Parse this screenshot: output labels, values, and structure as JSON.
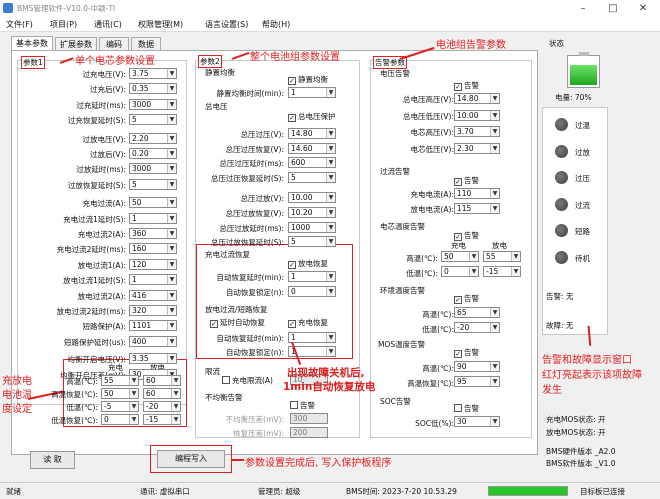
{
  "window": {
    "title": "BMS管理软件-V10.0-中颖-TI",
    "controls": [
      "–",
      "□",
      "✕"
    ]
  },
  "menu": [
    "文件(F)",
    "项目(P)",
    "通讯(C)",
    "权限管理(M)",
    "语言设置(S)",
    "帮助(H)"
  ],
  "tabs": [
    "基本参数",
    "扩展参数",
    "编码",
    "数据"
  ],
  "cell": {
    "title": "参数1",
    "rows": [
      [
        "过充电压(V):",
        "3.75"
      ],
      [
        "过充后(V):",
        "0.35"
      ],
      [
        "过充延时(ms):",
        "3000"
      ],
      [
        "过充恢复延时(S):",
        "5"
      ],
      [
        "过放电压(V):",
        "2.20"
      ],
      [
        "过放后(V):",
        "0.20"
      ],
      [
        "过放延时(ms):",
        "3000"
      ],
      [
        "过放恢复延时(S):",
        "5"
      ],
      [
        "充电过流(A):",
        "50"
      ],
      [
        "充电过流1延时(S):",
        "1"
      ],
      [
        "充电过流2(A):",
        "360"
      ],
      [
        "充电过流2延时(ms):",
        "160"
      ],
      [
        "放电过流1(A):",
        "120"
      ],
      [
        "放电过流1延时(S):",
        "1"
      ],
      [
        "放电过流2(A):",
        "416"
      ],
      [
        "放电过流2延时(ms):",
        "320"
      ],
      [
        "短路保护(A):",
        "1101"
      ],
      [
        "短路保护延时(us):",
        "400"
      ],
      [
        "均衡开启电压(V):",
        "3.35"
      ],
      [
        "均衡开启压差(mV):",
        "30"
      ]
    ],
    "temp": {
      "h1": "充电",
      "h2": "放电",
      "rows": [
        [
          "高温(℃):",
          "55",
          "60"
        ],
        [
          "高温恢复(℃):",
          "50",
          "60"
        ],
        [
          "低温(℃):",
          "-5",
          "-20"
        ],
        [
          "低温恢复(℃):",
          "0",
          "-15"
        ]
      ]
    }
  },
  "pack": {
    "title": "参数2",
    "equalize": {
      "title": "静置均衡",
      "check": "静置均衡",
      "row": [
        "静置均衡时间(min):",
        "1"
      ]
    },
    "voltage": {
      "title": "总电压",
      "check": "总电压保护",
      "rows": [
        [
          "总压过压(V):",
          "14.80"
        ],
        [
          "总压过压恢复(V):",
          "14.60"
        ],
        [
          "总压过压延时(ms):",
          "600"
        ],
        [
          "总压过压恢复延时(S):",
          "5"
        ],
        [
          "总压过放(V):",
          "10.00"
        ],
        [
          "总压过放恢复(V):",
          "10.20"
        ],
        [
          "总压过放延时(ms):",
          "1000"
        ],
        [
          "总压过放恢复延时(S):",
          "5"
        ]
      ]
    },
    "charge_oc": {
      "title": "充电过流恢复",
      "check": "放电恢复",
      "rows": [
        [
          "自动恢复延时(min):",
          "1"
        ],
        [
          "自动恢复锁定(n):",
          "0"
        ]
      ]
    },
    "discharge_oc": {
      "title": "放电过流/短路恢复",
      "check1": "延时自动恢复",
      "check2": "充电恢复",
      "rows": [
        [
          "自动恢复延时(min):",
          "1"
        ],
        [
          "自动恢复锁定(n):",
          "1"
        ]
      ]
    },
    "limit": {
      "title": "限流",
      "check": "充电限流(A)",
      "value": "10"
    },
    "imbalance": {
      "title": "不均衡告警",
      "check": "告警",
      "rows": [
        [
          "不均衡压差(mV):",
          "300"
        ],
        [
          "恢复压差(mV):",
          "200"
        ]
      ]
    }
  },
  "alarm": {
    "title": "告警参数",
    "voltage": {
      "title": "电压告警",
      "check": "告警",
      "rows": [
        [
          "总电压高压(V):",
          "14.80"
        ],
        [
          "总电压低压(V):",
          "10.00"
        ],
        [
          "电芯高压(V):",
          "3.70"
        ],
        [
          "电芯低压(V):",
          "2.30"
        ]
      ]
    },
    "current": {
      "title": "过流告警",
      "check": "告警",
      "rows": [
        [
          "充电电流(A):",
          "110"
        ],
        [
          "放电电流(A):",
          "115"
        ]
      ]
    },
    "cell_temp": {
      "title": "电芯温度告警",
      "check": "告警",
      "h1": "充电",
      "h2": "放电",
      "rows": [
        [
          "高温(℃):",
          "50",
          "55"
        ],
        [
          "低温(℃):",
          "0",
          "-15"
        ]
      ]
    },
    "env_temp": {
      "title": "环境温度告警",
      "check": "告警",
      "rows": [
        [
          "高温(℃):",
          "65"
        ],
        [
          "低温(℃):",
          "-20"
        ]
      ]
    },
    "mos_temp": {
      "title": "MOS温度告警",
      "check": "告警",
      "rows": [
        [
          "高温(℃):",
          "90"
        ],
        [
          "高温恢复(℃):",
          "95"
        ]
      ]
    },
    "soc": {
      "title": "SOC告警",
      "check": "告警",
      "row": [
        "SOC低(%):",
        "30"
      ]
    }
  },
  "status": {
    "title": "状态",
    "soc_label": "电量: 70%",
    "soc_fraction": 0.7,
    "leds": [
      "过温",
      "过放",
      "过压",
      "过流",
      "短路",
      "待机"
    ],
    "alarm": "告警: 无",
    "fault": "故障: 无",
    "info": [
      "充电MOS状态: 开",
      "放电MOS状态: 开",
      "BMS硬件版本 _A2.0",
      "BMS软件版本 _V1.0"
    ]
  },
  "buttons": {
    "read": "读 取",
    "write": "编程写入"
  },
  "statusbar": {
    "ready": "就绪",
    "comm": "通讯: 虚拟串口",
    "admin": "管理员: 超级",
    "time": "BMS时间: 2023-7-20 10.53.29",
    "progress": 1.0,
    "board": "目标板已连接"
  },
  "annotations": {
    "single_cell": "单个电芯参数设置",
    "pack": "整个电池组参数设置",
    "group_alarm": "电池组告警参数",
    "temp": [
      "充放电",
      "电池温",
      "度设定"
    ],
    "recover": [
      "出现故障关机后,",
      "1min自动恢复放电"
    ],
    "write": "参数设置完成后, 写入保护板程序",
    "status": [
      "告警和故障显示窗口",
      "红灯亮起表示该项故障",
      "发生"
    ]
  },
  "colors": {
    "annotation": "#e02020",
    "battery": "#2fbf2f",
    "progress": "#27c427"
  }
}
